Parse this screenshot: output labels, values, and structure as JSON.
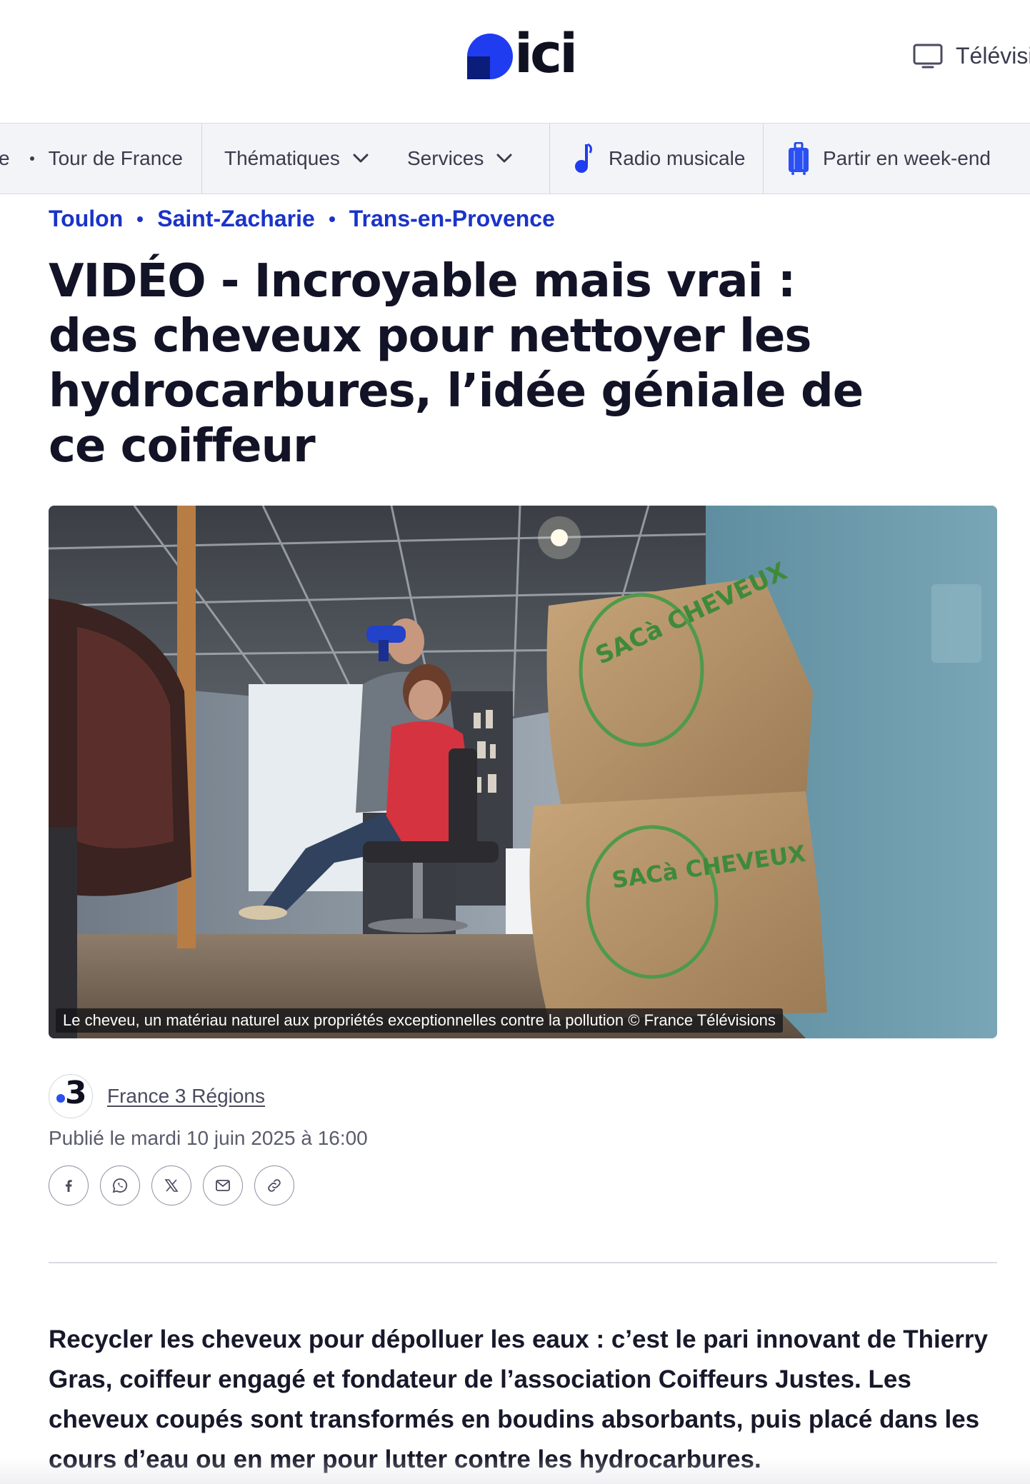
{
  "header": {
    "logo_text": "ici",
    "tv_label": "Télévisi"
  },
  "nav": {
    "partial_first": "e",
    "items": [
      {
        "label": "Tour de France"
      },
      {
        "label": "Thématiques"
      },
      {
        "label": "Services"
      },
      {
        "label": "Radio musicale",
        "icon": "music-note-icon"
      },
      {
        "label": "Partir en week-end",
        "icon": "suitcase-icon"
      }
    ]
  },
  "breadcrumb": [
    "Toulon",
    "Saint-Zacharie",
    "Trans-en-Provence"
  ],
  "article": {
    "title": "VIDÉO - Incroyable mais vrai : des cheveux pour nettoyer les hydrocarbures, l’idée géniale de ce coiffeur",
    "image_caption": "Le cheveu, un matériau naturel aux propriétés exceptionnelles contre la pollution © France Télévisions",
    "bag_label_top": "SACà CHEVEUX",
    "bag_label_bottom": "SACà CHEVEUX",
    "source_badge": "3",
    "source_name": "France 3 Régions",
    "published": "Publié le mardi 10 juin 2025 à 16:00",
    "lead": "Recycler les cheveux pour dépolluer les eaux : c’est le pari innovant de Thierry Gras, coiffeur engagé et fondateur de l’association Coiffeurs Justes. Les cheveux coupés sont transformés en boudins absorbants, puis placé dans les cours d’eau ou en mer pour lutter contre les hydrocarbures."
  },
  "share": [
    "facebook-icon",
    "whatsapp-icon",
    "x-icon",
    "mail-icon",
    "link-icon"
  ],
  "colors": {
    "brand_blue": "#1f3cf0",
    "link_blue": "#1a33c9",
    "text_dark": "#121326"
  }
}
